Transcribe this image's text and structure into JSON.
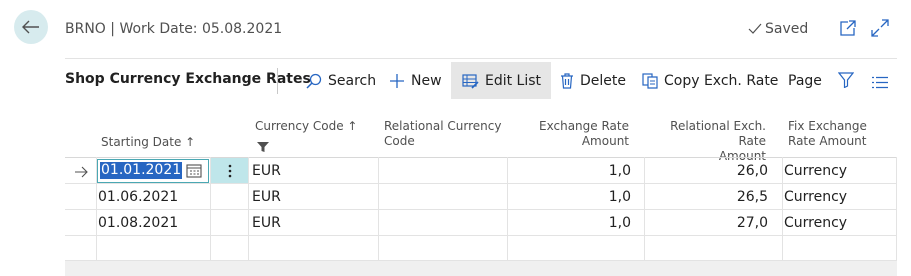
{
  "header": {
    "context": "BRNO | Work Date: 05.08.2021",
    "saved": "Saved"
  },
  "page": {
    "title": "Shop Currency Exchange Rates"
  },
  "actions": {
    "search": "Search",
    "new": "New",
    "edit_list": "Edit List",
    "delete": "Delete",
    "copy_exch_rate": "Copy Exch. Rate",
    "page": "Page"
  },
  "columns": {
    "starting_date": "Starting Date ↑",
    "currency_code": "Currency Code ↑",
    "relational_currency_code_1": "Relational Currency",
    "relational_currency_code_2": "Code",
    "exchange_rate_amount_1": "Exchange Rate",
    "exchange_rate_amount_2": "Amount",
    "relational_exch_rate_1": "Relational Exch. Rate",
    "relational_exch_rate_2": "Amount",
    "fix_exchange_rate_1": "Fix Exchange",
    "fix_exchange_rate_2": "Rate Amount"
  },
  "rows": [
    {
      "starting_date": "01.01.2021",
      "currency_code": "EUR",
      "relational_currency_code": "",
      "exchange_rate_amount": "1,0",
      "relational_exch_rate_amount": "26,0",
      "fix_exchange_rate_amount": "Currency"
    },
    {
      "starting_date": "01.06.2021",
      "currency_code": "EUR",
      "relational_currency_code": "",
      "exchange_rate_amount": "1,0",
      "relational_exch_rate_amount": "26,5",
      "fix_exchange_rate_amount": "Currency"
    },
    {
      "starting_date": "01.08.2021",
      "currency_code": "EUR",
      "relational_currency_code": "",
      "exchange_rate_amount": "1,0",
      "relational_exch_rate_amount": "27,0",
      "fix_exchange_rate_amount": "Currency"
    }
  ],
  "colors": {
    "accent": "#2766c2",
    "teal": "#4aa8b3",
    "back_bg": "#d7ebee"
  }
}
